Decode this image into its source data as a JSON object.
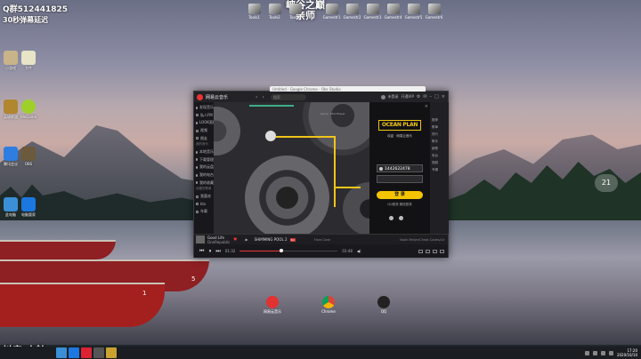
{
  "overlay": {
    "qq_group": "Q群512441825",
    "danmu_delay": "30秒弹幕延迟",
    "title_line1": "峡谷之巅",
    "title_line2": "亲师",
    "douyin": "抖音:小韩"
  },
  "top_dock": [
    "Tools1",
    "Tools2",
    "Tools3",
    "Gamestr1",
    "Gamestr2",
    "Gamestr3",
    "Gamestr4",
    "Gamestr5",
    "Gamestr6"
  ],
  "weather": {
    "temp": "21"
  },
  "music_app": {
    "title": "网易云音乐",
    "search_placeholder": "搜索",
    "browser_tab": "Untitled - Google Chrome - Obs Studio",
    "header_user": "未登录",
    "header_vip": "开通VIP",
    "sidebar": [
      "发现音乐",
      "私人FM",
      "LOOK直播",
      "视频",
      "朋友"
    ],
    "sidebar_section_1": "我的音乐",
    "sidebar_2": [
      "本地音乐",
      "下载管理",
      "我的云盘",
      "我的电台",
      "我的收藏"
    ],
    "sidebar_section_2": "创建的歌单",
    "sidebar_3": [
      "我喜欢",
      "ktv",
      "车载"
    ],
    "caption": "Lyrics · Mini Player",
    "login": {
      "brand": "OCEAN PLAN",
      "slogan": "欢迎 · 网易云音乐",
      "account": "1442622478",
      "button": "登 录",
      "sub": "QQ登录 微信登录",
      "close": "×"
    },
    "right_strip": [
      "推荐",
      "歌单",
      "排行",
      "歌手",
      "新歌",
      "电台",
      "视频",
      "专辑"
    ],
    "now_playing": {
      "song": "Good Life",
      "artist": "OneRepublic",
      "tag": "SHIMMING POOL 2",
      "quality": "SQ",
      "extra": "Flora Cash",
      "extra2": "Noah Meijer/Cheat Codes/Lit"
    },
    "controls": {
      "current": "01:32",
      "total": "03:48",
      "progress": 0.42
    }
  },
  "desktop_icons": [
    {
      "label": "小游戏"
    },
    {
      "label": "文件"
    },
    {
      "label": "英雄联盟"
    },
    {
      "label": "WeGame"
    },
    {
      "label": "腾讯会议"
    },
    {
      "label": "OBS"
    },
    {
      "label": "此电脑"
    },
    {
      "label": "电脑管家"
    }
  ],
  "bottom_icons": [
    {
      "label": "网易云音乐"
    },
    {
      "label": "Chrome"
    },
    {
      "label": "QQ"
    }
  ],
  "clock": {
    "time": "17:20",
    "date": "2020/10/10"
  }
}
